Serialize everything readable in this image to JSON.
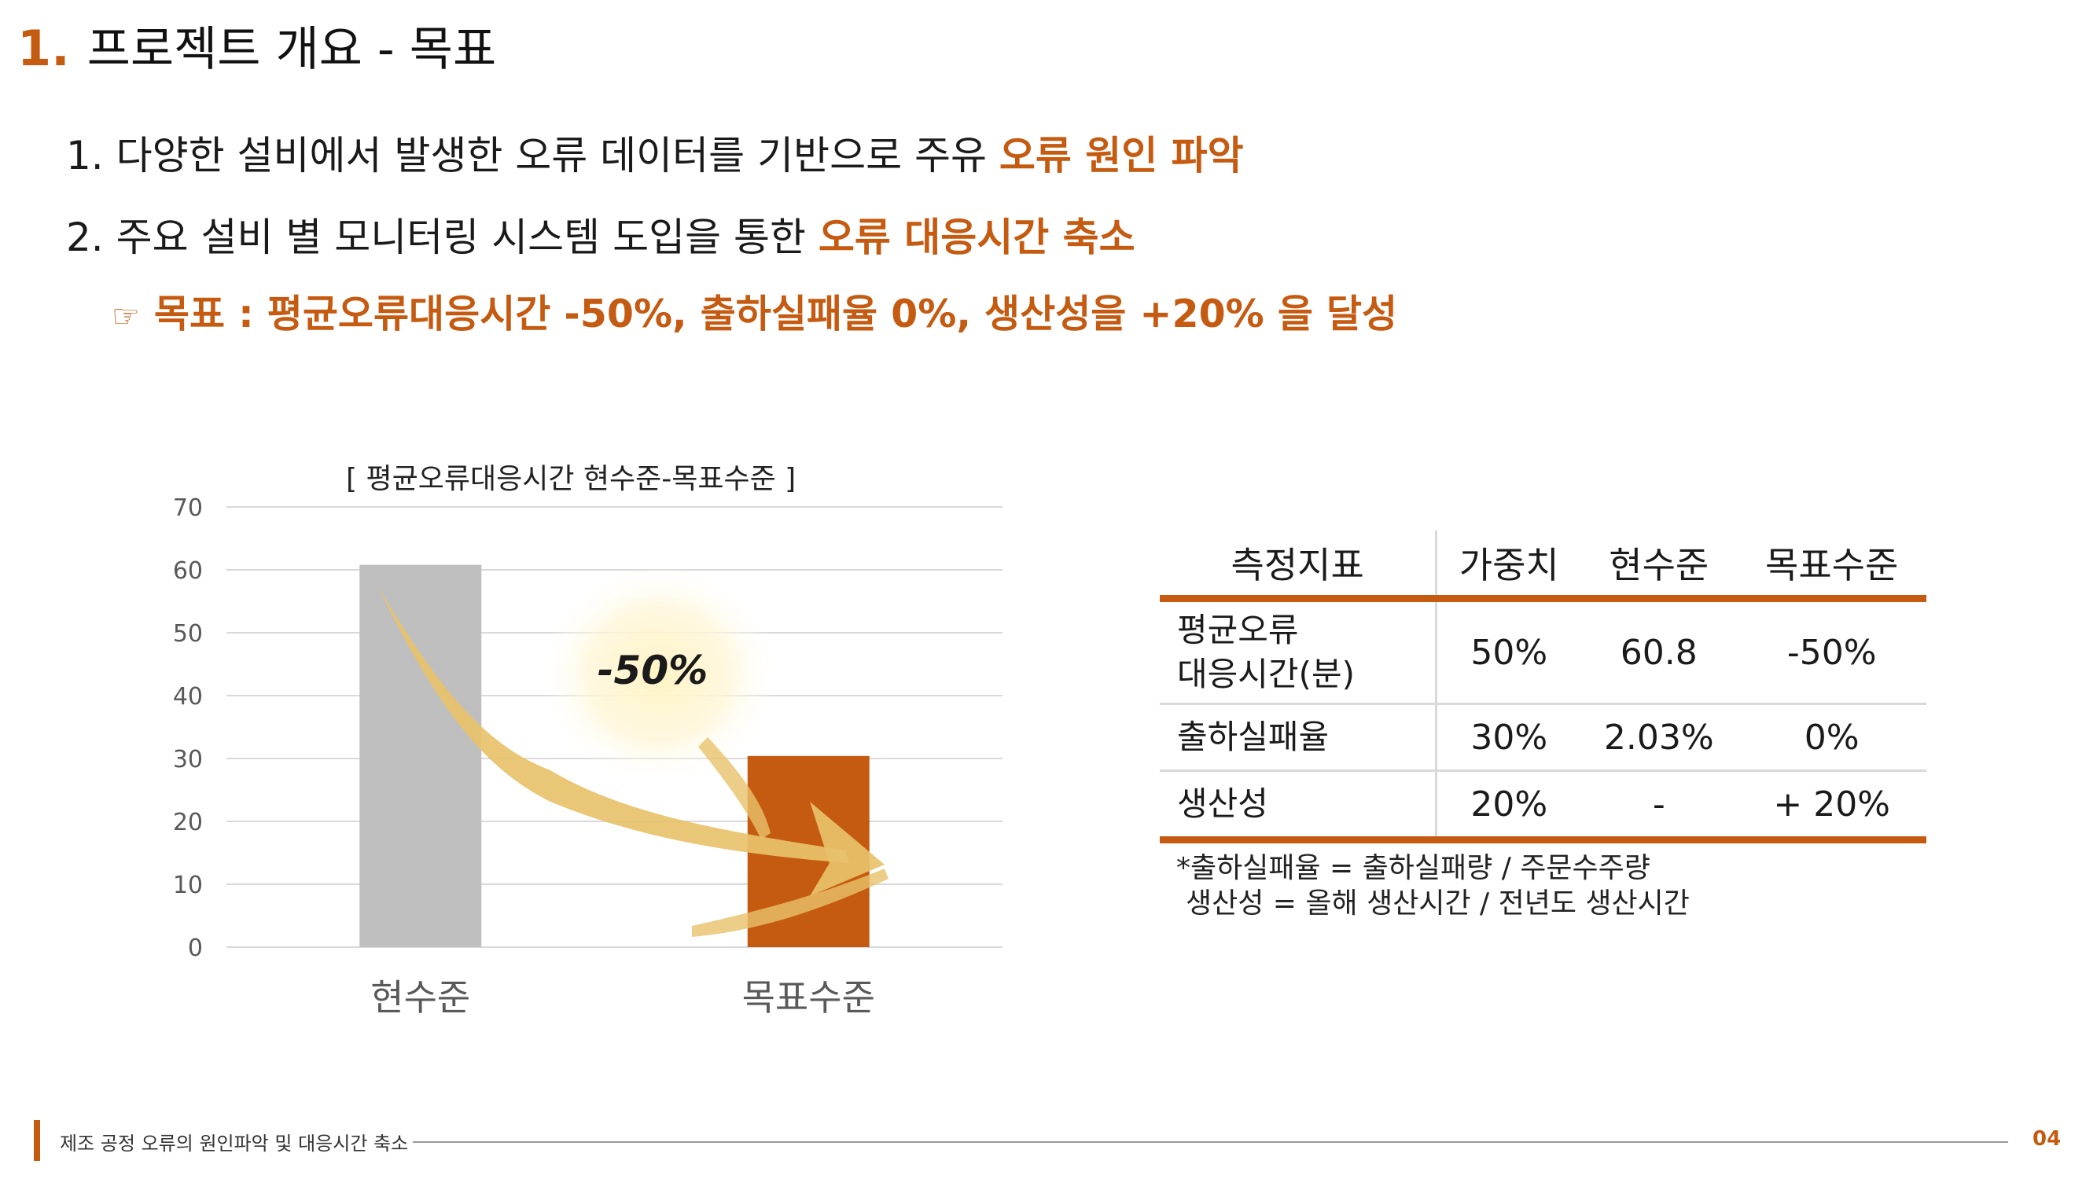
{
  "slide": {
    "title_number": "1.",
    "title_text": "프로젝트 개요 - 목표"
  },
  "goals": [
    {
      "prefix": "1. 다양한 설비에서 발생한 오류 데이터를 기반으로 주유 ",
      "highlight": "오류 원인 파악"
    },
    {
      "prefix": "2. 주요 설비 별 모니터링 시스템 도입을 통한 ",
      "highlight": "오류 대응시간 축소"
    }
  ],
  "target": {
    "icon": "pointing-hand-icon",
    "hand_glyph": "☞",
    "text": "목표 : 평균오류대응시간 -50%, 출하실패율 0%, 생산성을 +20% 을 달성"
  },
  "chart_data": {
    "type": "bar",
    "title": "[ 평균오류대응시간 현수준-목표수준 ]",
    "categories": [
      "현수준",
      "목표수준"
    ],
    "values": [
      60.8,
      30.4
    ],
    "bar_colors": [
      "#bfbfbf",
      "#c55a11"
    ],
    "ylim": [
      0,
      70
    ],
    "yticks": [
      0,
      10,
      20,
      30,
      40,
      50,
      60,
      70
    ],
    "grid": true,
    "annotation": "-50%",
    "arrow_color": "#e8c26a"
  },
  "table": {
    "headers": [
      "측정지표",
      "가중치",
      "현수준",
      "목표수준"
    ],
    "rows": [
      {
        "metric": [
          "평균오류",
          "대응시간(분)"
        ],
        "weight": "50%",
        "current": "60.8",
        "target": "-50%"
      },
      {
        "metric": [
          "출하실패율"
        ],
        "weight": "30%",
        "current": "2.03%",
        "target": "0%"
      },
      {
        "metric": [
          "생산성"
        ],
        "weight": "20%",
        "current": "-",
        "target": "+ 20%"
      }
    ],
    "accent_color": "#c55a11"
  },
  "notes": [
    "*출하실패율 = 출하실패량 / 주문수주량",
    "생산성 = 올해 생산시간 / 전년도 생산시간"
  ],
  "footer": {
    "text": "제조 공정 오류의 원인파악 및 대응시간 축소",
    "page": "04"
  }
}
